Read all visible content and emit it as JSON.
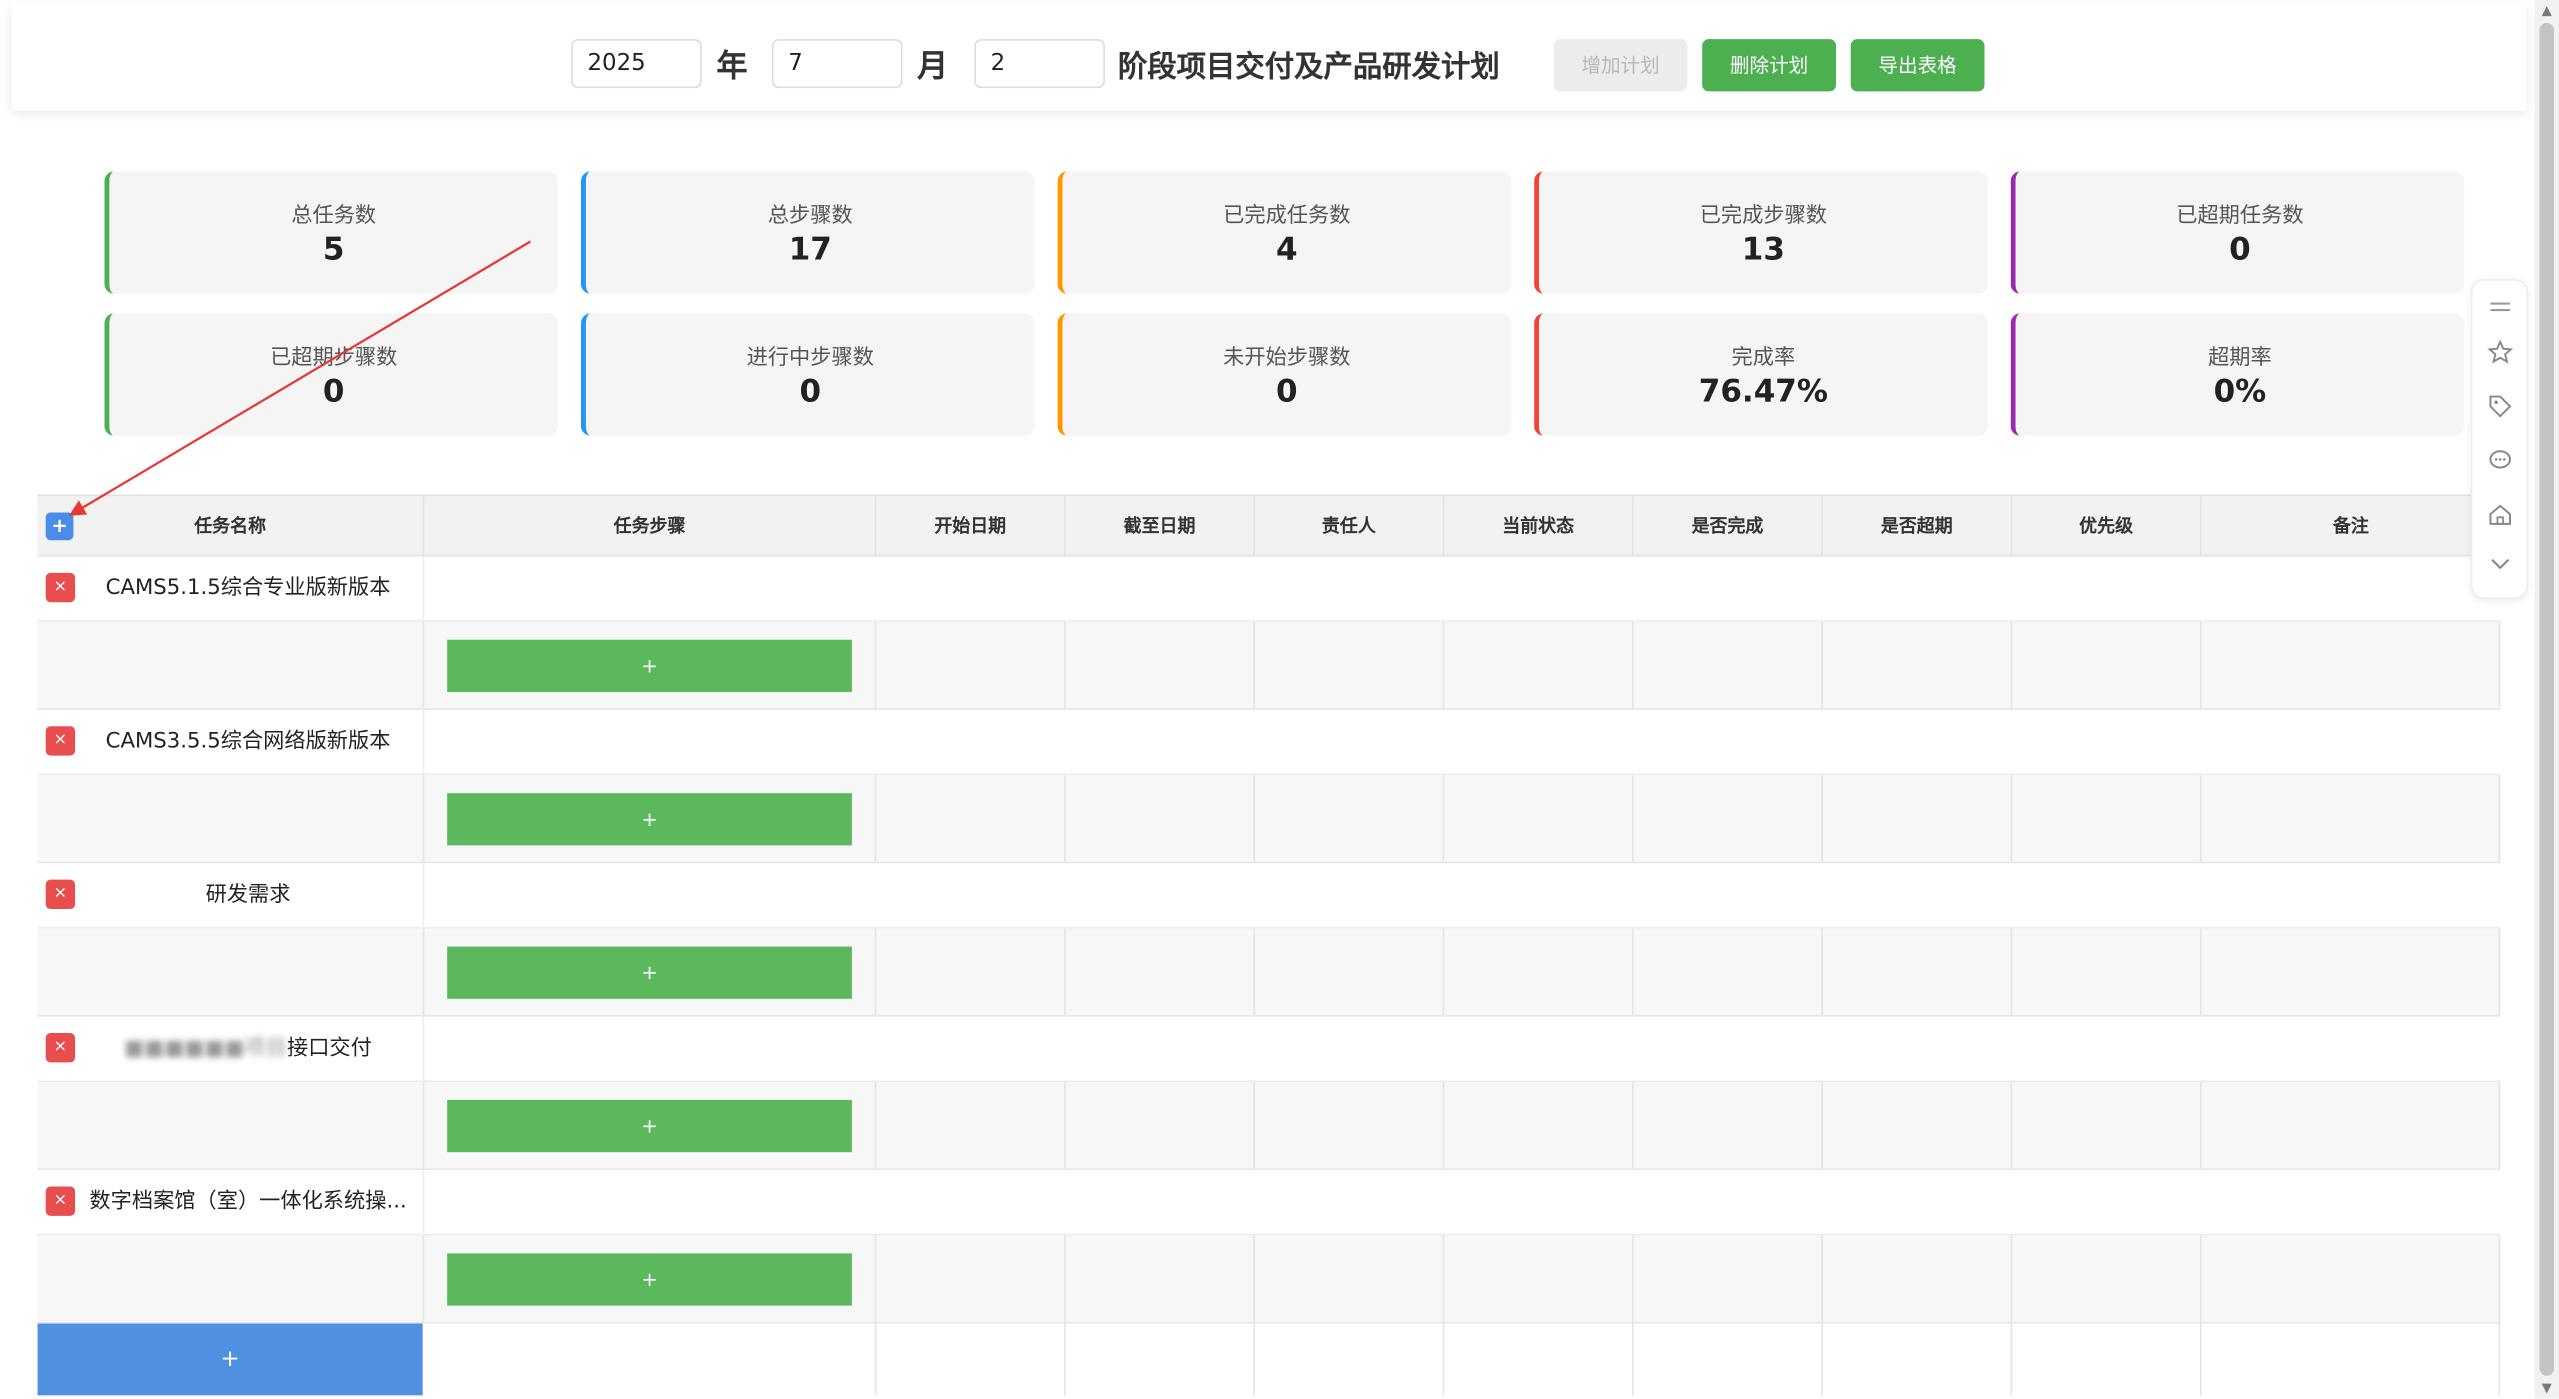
{
  "header": {
    "year": "2025",
    "year_label": "年",
    "month": "7",
    "month_label": "月",
    "phase": "2",
    "title": "阶段项目交付及产品研发计划",
    "buttons": {
      "add_plan": "增加计划",
      "delete_plan": "删除计划",
      "export_table": "导出表格"
    }
  },
  "stats": [
    {
      "label": "总任务数",
      "value": "5",
      "color": "#4caf50"
    },
    {
      "label": "总步骤数",
      "value": "17",
      "color": "#2196f3"
    },
    {
      "label": "已完成任务数",
      "value": "4",
      "color": "#ff9800"
    },
    {
      "label": "已完成步骤数",
      "value": "13",
      "color": "#f44336"
    },
    {
      "label": "已超期任务数",
      "value": "0",
      "color": "#9c27b0"
    },
    {
      "label": "已超期步骤数",
      "value": "0",
      "color": "#4caf50"
    },
    {
      "label": "进行中步骤数",
      "value": "0",
      "color": "#2196f3"
    },
    {
      "label": "未开始步骤数",
      "value": "0",
      "color": "#ff9800"
    },
    {
      "label": "完成率",
      "value": "76.47%",
      "color": "#f44336"
    },
    {
      "label": "超期率",
      "value": "0%",
      "color": "#9c27b0"
    }
  ],
  "table": {
    "add_head_symbol": "+",
    "columns": [
      "任务名称",
      "任务步骤",
      "开始日期",
      "截至日期",
      "责任人",
      "当前状态",
      "是否完成",
      "是否超期",
      "优先级",
      "备注"
    ],
    "tasks": [
      {
        "name": "CAMS5.1.5综合专业版新版本",
        "blurred": false
      },
      {
        "name": "CAMS3.5.5综合网络版新版本",
        "blurred": false
      },
      {
        "name": "研发需求",
        "blurred": false
      },
      {
        "name_hidden": "■■■■■■项目",
        "name": "接口交付",
        "blurred": true
      },
      {
        "name": "数字档案馆（室）一体化系统操...",
        "blurred": false
      }
    ],
    "delete_symbol": "×",
    "add_step_symbol": "+",
    "add_task_symbol": "+"
  },
  "floatbar": {
    "icons": [
      "menu-icon",
      "star-icon",
      "tag-icon",
      "comment-icon",
      "home-icon",
      "chevron-down-icon"
    ]
  },
  "annotation": {
    "color": "#e53935"
  }
}
